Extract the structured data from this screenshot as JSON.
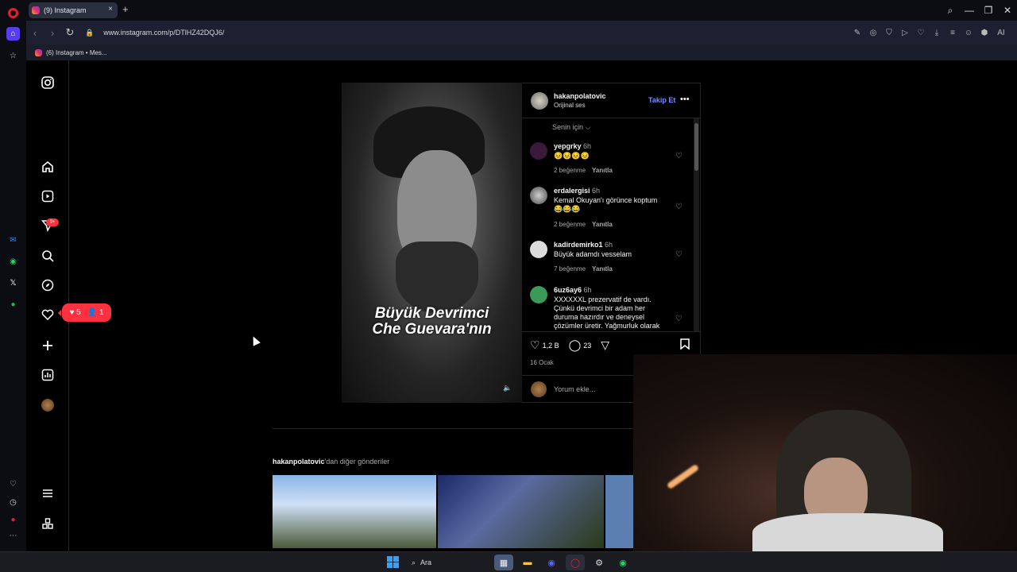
{
  "browser": {
    "tab_title": "(9) Instagram",
    "url": "www.instagram.com/p/DTlHZ42DQJ6/",
    "bookmark_label": "(6) Instagram • Mes...",
    "new_tab_symbol": "+",
    "close_symbol": "×",
    "window_controls": [
      "⌕",
      "—",
      "❐",
      "✕"
    ],
    "extension_label": "AI"
  },
  "instagram_nav": {
    "notification_badge": "9+",
    "activity_popup": {
      "likes": "5",
      "follows": "1"
    }
  },
  "video": {
    "caption_line1": "Büyük Devrimci",
    "caption_line2": "Che Guevara'nın"
  },
  "post": {
    "username": "hakanpolatovic",
    "audio": "Orijinal ses",
    "follow_label": "Takip Et",
    "sort_label": "Senin için ⌵",
    "comments": [
      {
        "user": "yepgrky",
        "time": "6h",
        "text": "😣😣😣😣",
        "likes": "2 beğenme",
        "reply": "Yanıtla"
      },
      {
        "user": "erdalergisi",
        "time": "6h",
        "text": "Kemal Okuyan'ı görünce koptum 😂😂😂",
        "likes": "2 beğenme",
        "reply": "Yanıtla"
      },
      {
        "user": "kadirdemirko1",
        "time": "6h",
        "text": "Büyük adamdı vesselam",
        "likes": "7 beğenme",
        "reply": "Yanıtla"
      },
      {
        "user": "6uz6ay6",
        "time": "6h",
        "text": "XXXXXXL prezervatif de vardı. Çünkü devrimci bir adam her duruma hazırdır ve deneysel çözümler üretir. Yağmurluk olarak",
        "likes": "",
        "reply": ""
      }
    ],
    "like_count": "1,2 B",
    "comment_count": "23",
    "date": "16 Ocak",
    "comment_placeholder": "Yorum ekle..."
  },
  "more_posts": {
    "user": "hakanpolatovic",
    "suffix": "'dan diğer gönderiler"
  },
  "taskbar": {
    "search_label": "Ara"
  }
}
